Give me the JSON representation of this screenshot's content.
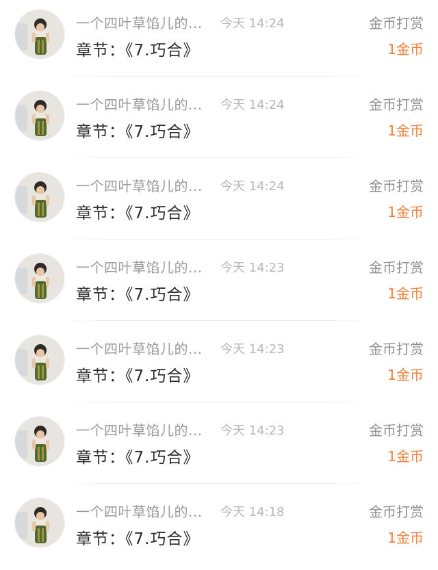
{
  "colors": {
    "name": "#9b9b9b",
    "time": "#b8b8b8",
    "type": "#8e8e8e",
    "chapter": "#2a2a2a",
    "amount": "#f0813c",
    "divider": "#ececec"
  },
  "records": [
    {
      "avatar_icon": "user-avatar",
      "name": "一个四叶草馅儿的...",
      "time": "今天 14:24",
      "type": "金币打赏",
      "chapter": "章节：《7.巧合》",
      "amount": "1金币"
    },
    {
      "avatar_icon": "user-avatar",
      "name": "一个四叶草馅儿的...",
      "time": "今天 14:24",
      "type": "金币打赏",
      "chapter": "章节：《7.巧合》",
      "amount": "1金币"
    },
    {
      "avatar_icon": "user-avatar",
      "name": "一个四叶草馅儿的...",
      "time": "今天 14:24",
      "type": "金币打赏",
      "chapter": "章节：《7.巧合》",
      "amount": "1金币"
    },
    {
      "avatar_icon": "user-avatar",
      "name": "一个四叶草馅儿的...",
      "time": "今天 14:23",
      "type": "金币打赏",
      "chapter": "章节：《7.巧合》",
      "amount": "1金币"
    },
    {
      "avatar_icon": "user-avatar",
      "name": "一个四叶草馅儿的...",
      "time": "今天 14:23",
      "type": "金币打赏",
      "chapter": "章节：《7.巧合》",
      "amount": "1金币"
    },
    {
      "avatar_icon": "user-avatar",
      "name": "一个四叶草馅儿的...",
      "time": "今天 14:23",
      "type": "金币打赏",
      "chapter": "章节：《7.巧合》",
      "amount": "1金币"
    },
    {
      "avatar_icon": "user-avatar",
      "name": "一个四叶草馅儿的...",
      "time": "今天 14:18",
      "type": "金币打赏",
      "chapter": "章节：《7.巧合》",
      "amount": "1金币"
    }
  ]
}
